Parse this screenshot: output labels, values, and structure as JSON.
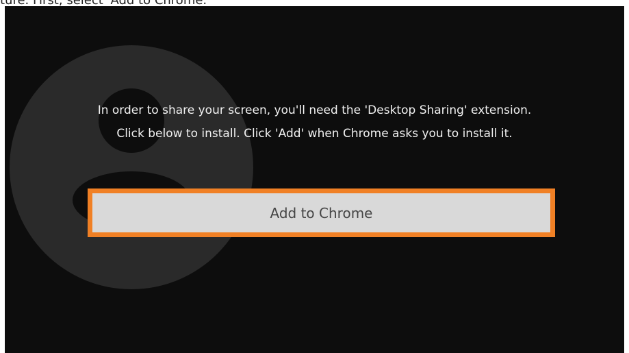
{
  "caption": {
    "text": "ture. First, select 'Add to Chrome.'"
  },
  "dialog": {
    "message": "In order to share your screen, you'll need the 'Desktop Sharing' extension. Click below to install. Click 'Add' when Chrome asks you to install it.",
    "button_label": "Add to Chrome",
    "avatar_icon": "user-silhouette-icon"
  },
  "colors": {
    "panel_background": "#0d0d0d",
    "avatar_fill": "#2a2a2a",
    "button_background": "#d9d9d9",
    "button_border": "#f08025",
    "message_text": "#f2f2f2"
  }
}
